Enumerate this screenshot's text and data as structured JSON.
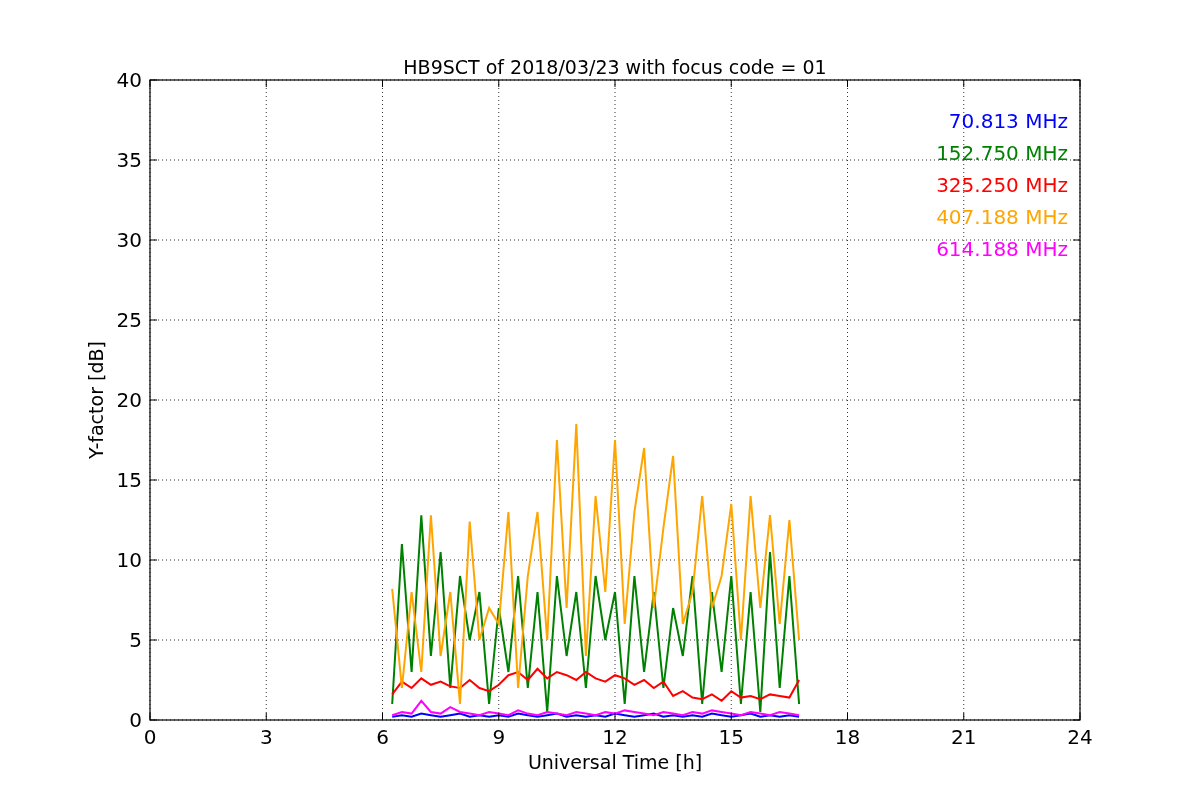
{
  "figure": {
    "chart_data": {
      "type": "line",
      "grid": true,
      "title": "HB9SCT of 2018/03/23 with focus code = 01",
      "xlabel": "Universal Time [h]",
      "ylabel": "Y-factor [dB]",
      "xlim": [
        0,
        24
      ],
      "ylim": [
        0,
        40
      ],
      "xticks": [
        0,
        3,
        6,
        9,
        12,
        15,
        18,
        21,
        24
      ],
      "yticks": [
        0,
        5,
        10,
        15,
        20,
        25,
        30,
        35,
        40
      ],
      "x": [
        6.25,
        6.5,
        6.75,
        7,
        7.25,
        7.5,
        7.75,
        8,
        8.25,
        8.5,
        8.75,
        9,
        9.25,
        9.5,
        9.75,
        10,
        10.25,
        10.5,
        10.75,
        11,
        11.25,
        11.5,
        11.75,
        12,
        12.25,
        12.5,
        12.75,
        13,
        13.25,
        13.5,
        13.75,
        14,
        14.25,
        14.5,
        14.75,
        15,
        15.25,
        15.5,
        15.75,
        16,
        16.25,
        16.5,
        16.75
      ],
      "series": [
        {
          "name": "70.813 MHz",
          "color": "#0000ff",
          "values": [
            0.2,
            0.3,
            0.2,
            0.4,
            0.3,
            0.2,
            0.3,
            0.4,
            0.2,
            0.3,
            0.2,
            0.3,
            0.2,
            0.4,
            0.3,
            0.2,
            0.3,
            0.4,
            0.2,
            0.3,
            0.2,
            0.3,
            0.2,
            0.4,
            0.3,
            0.2,
            0.3,
            0.4,
            0.2,
            0.3,
            0.2,
            0.3,
            0.2,
            0.4,
            0.3,
            0.2,
            0.3,
            0.4,
            0.2,
            0.3,
            0.2,
            0.3,
            0.2
          ]
        },
        {
          "name": "152.750 MHz",
          "color": "#008000",
          "values": [
            1,
            11,
            3,
            12.8,
            4,
            10.5,
            2,
            9,
            5,
            8,
            1,
            7,
            3,
            9,
            2,
            8,
            0.5,
            9,
            4,
            8,
            2,
            9,
            5,
            8,
            1,
            9,
            3,
            8,
            2,
            7,
            4,
            9,
            1,
            8,
            3,
            9,
            1,
            8,
            0.5,
            10.5,
            2,
            9,
            1
          ]
        },
        {
          "name": "325.250 MHz",
          "color": "#ff0000",
          "values": [
            1.6,
            2.4,
            2,
            2.6,
            2.2,
            2.4,
            2.1,
            2,
            2.5,
            2,
            1.8,
            2.2,
            2.8,
            3,
            2.5,
            3.2,
            2.6,
            3,
            2.8,
            2.5,
            3,
            2.6,
            2.4,
            2.8,
            2.6,
            2.2,
            2.5,
            2,
            2.4,
            1.5,
            1.8,
            1.4,
            1.3,
            1.6,
            1.2,
            1.8,
            1.4,
            1.5,
            1.3,
            1.6,
            1.5,
            1.4,
            2.5
          ]
        },
        {
          "name": "407.188 MHz",
          "color": "#ffa500",
          "values": [
            8.2,
            2,
            8,
            3,
            12.8,
            4,
            8,
            1,
            12.4,
            5,
            7,
            6,
            13,
            2,
            9,
            13,
            5,
            17.5,
            7,
            18.5,
            4,
            14,
            8,
            17.5,
            6,
            13,
            17,
            7,
            12,
            16.5,
            6,
            8,
            14,
            7,
            9,
            13.5,
            5,
            14,
            7,
            12.8,
            6,
            12.5,
            5
          ]
        },
        {
          "name": "614.188 MHz",
          "color": "#ff00ff",
          "values": [
            0.3,
            0.5,
            0.4,
            1.2,
            0.5,
            0.4,
            0.8,
            0.5,
            0.4,
            0.3,
            0.5,
            0.4,
            0.3,
            0.6,
            0.4,
            0.3,
            0.5,
            0.4,
            0.3,
            0.5,
            0.4,
            0.3,
            0.5,
            0.4,
            0.6,
            0.5,
            0.4,
            0.3,
            0.5,
            0.4,
            0.3,
            0.5,
            0.4,
            0.6,
            0.5,
            0.4,
            0.3,
            0.5,
            0.4,
            0.3,
            0.5,
            0.4,
            0.3
          ]
        }
      ]
    }
  }
}
